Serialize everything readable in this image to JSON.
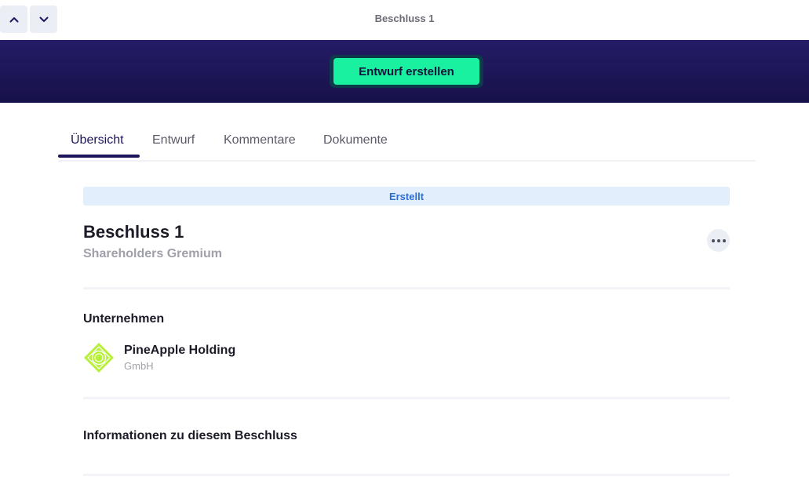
{
  "header": {
    "title": "Beschluss 1",
    "nav_up_icon": "chevron-up-icon",
    "nav_down_icon": "chevron-down-icon"
  },
  "banner": {
    "create_button_label": "Entwurf erstellen",
    "background_color": "#1f1860",
    "button_color": "#19f0a0"
  },
  "tabs": [
    {
      "label": "Übersicht",
      "active": true
    },
    {
      "label": "Entwurf",
      "active": false
    },
    {
      "label": "Kommentare",
      "active": false
    },
    {
      "label": "Dokumente",
      "active": false
    }
  ],
  "resolution": {
    "status": "Erstellt",
    "title": "Beschluss 1",
    "body": "Shareholders Gremium",
    "more_icon": "more-horizontal-icon"
  },
  "company": {
    "heading": "Unternehmen",
    "name": "PineApple Holding",
    "legal_form": "GmbH",
    "logo_color": "#b6f03a"
  },
  "info": {
    "heading": "Informationen zu diesem Beschluss"
  }
}
